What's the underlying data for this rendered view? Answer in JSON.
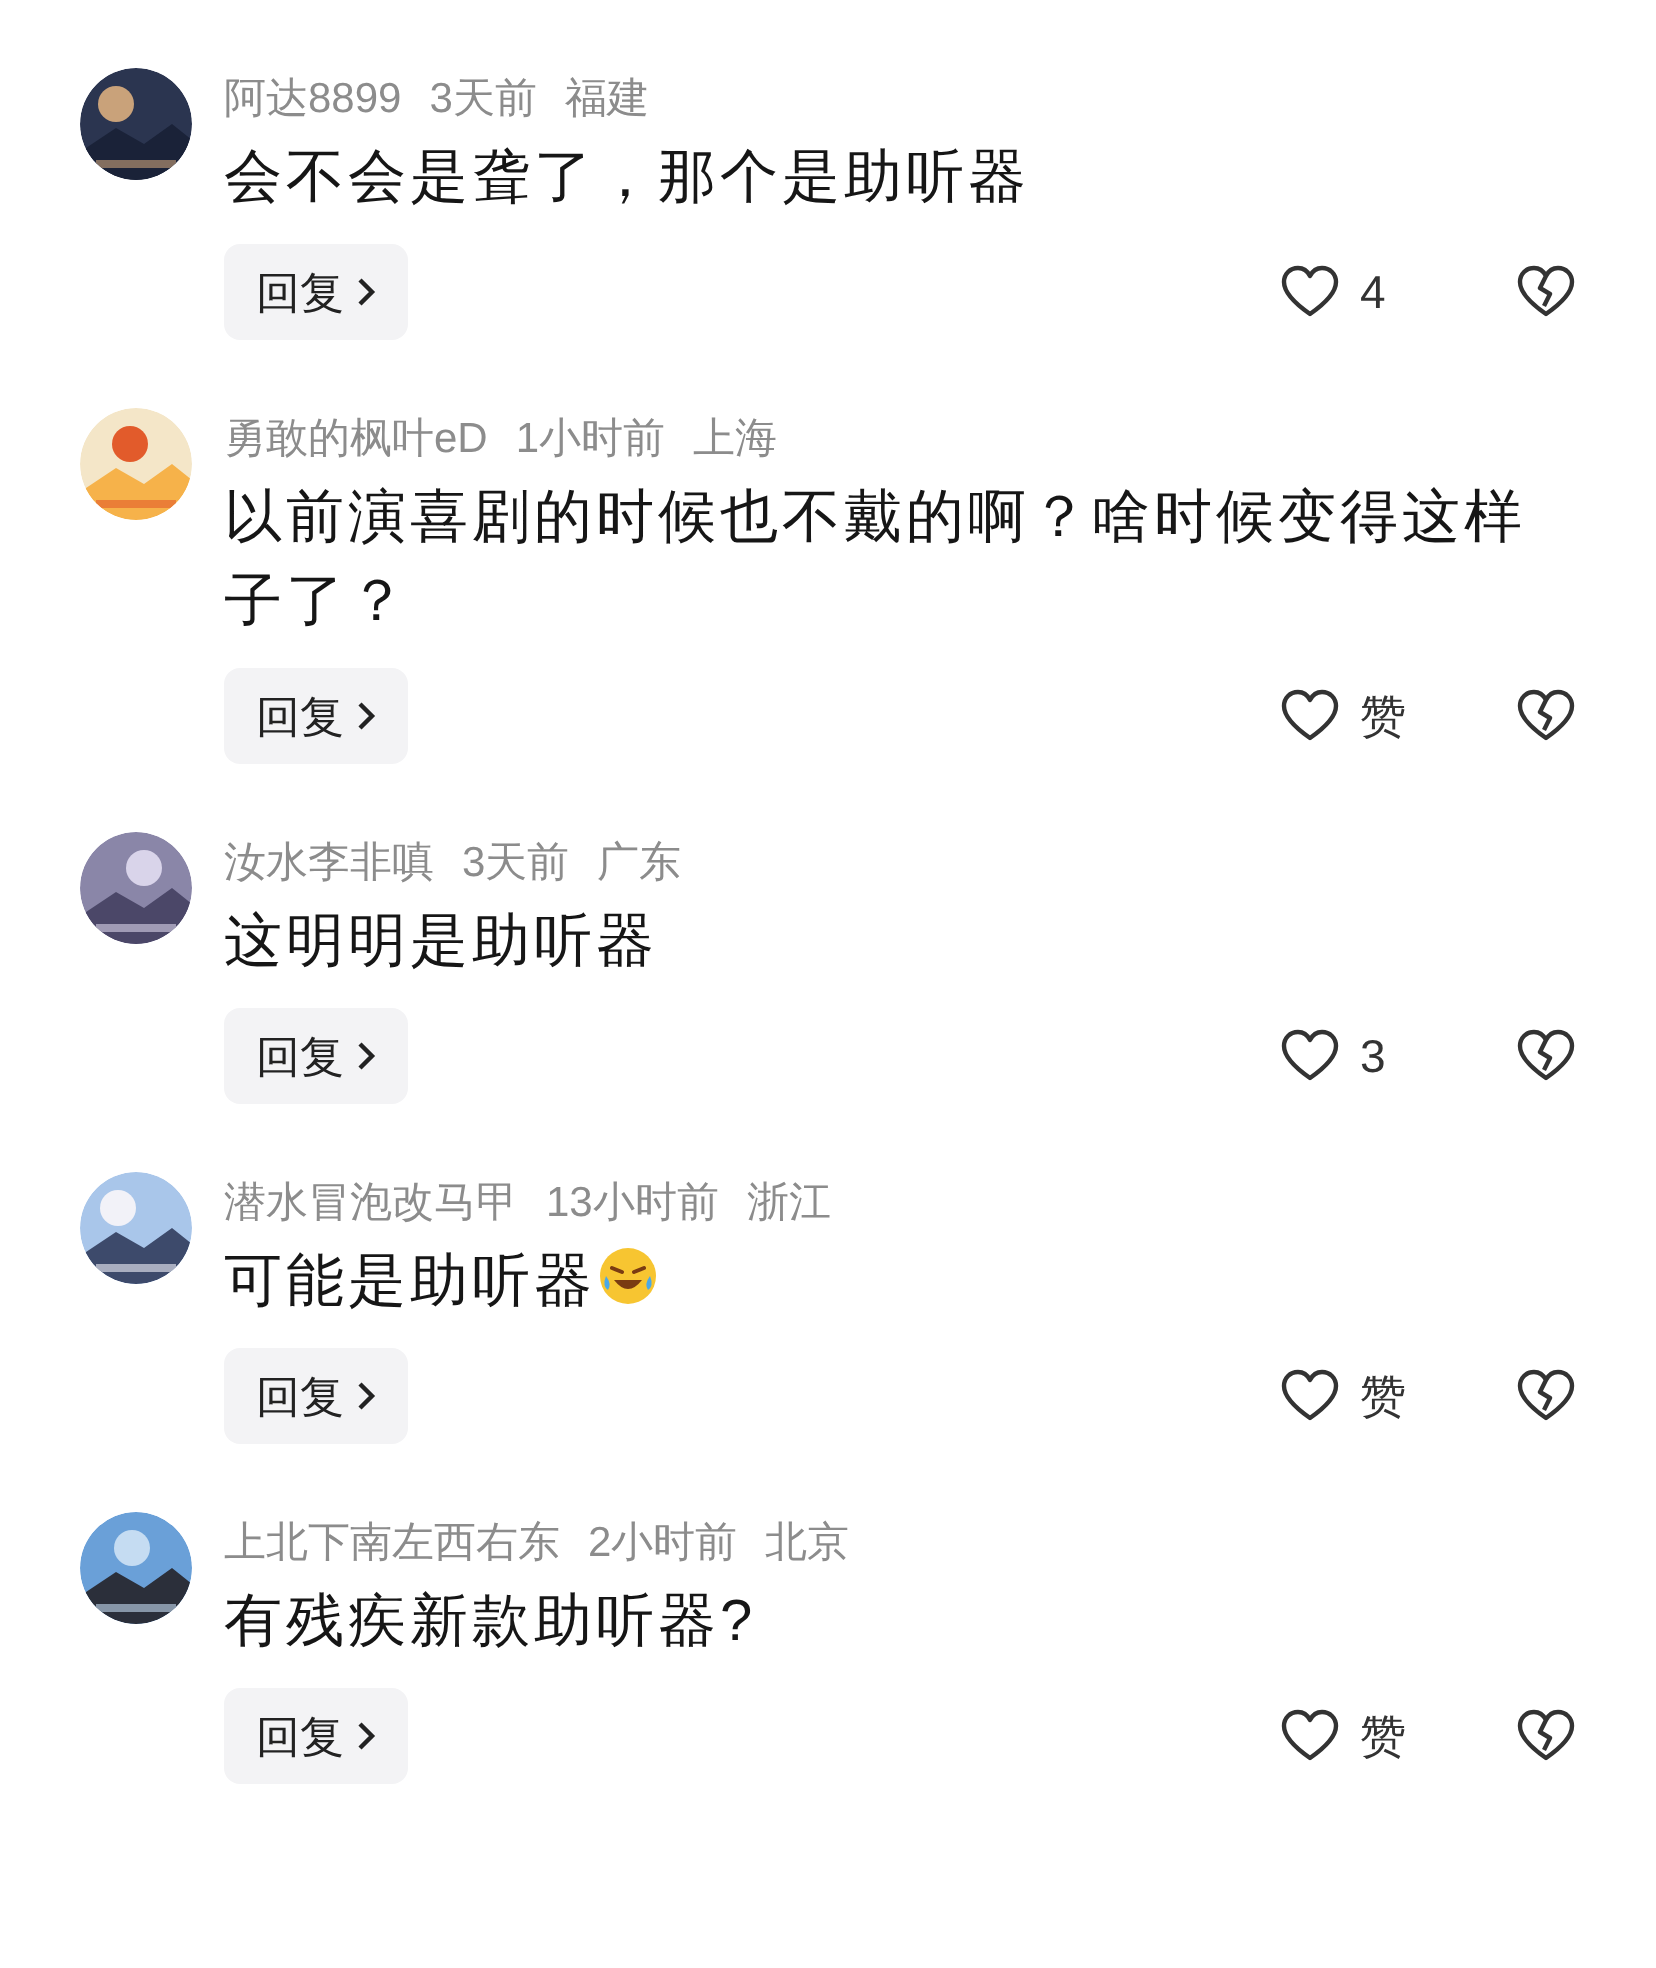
{
  "comments": [
    {
      "name": "阿达8899",
      "time": "3天前",
      "location": "福建",
      "text": "会不会是聋了，那个是助听器",
      "emoji": false,
      "reply": "回复",
      "likes": "4"
    },
    {
      "name": "勇敢的枫叶eD",
      "time": "1小时前",
      "location": "上海",
      "text": "以前演喜剧的时候也不戴的啊？啥时候变得这样子了？",
      "emoji": false,
      "reply": "回复",
      "likes": "赞"
    },
    {
      "name": "汝水李非嗔",
      "time": "3天前",
      "location": "广东",
      "text": "这明明是助听器",
      "emoji": false,
      "reply": "回复",
      "likes": "3"
    },
    {
      "name": "潜水冒泡改马甲",
      "time": "13小时前",
      "location": "浙江",
      "text": "可能是助听器",
      "emoji": true,
      "reply": "回复",
      "likes": "赞"
    },
    {
      "name": "上北下南左西右东",
      "time": "2小时前",
      "location": "北京",
      "text": "有残疾新款助听器?",
      "emoji": false,
      "reply": "回复",
      "likes": "赞"
    }
  ]
}
